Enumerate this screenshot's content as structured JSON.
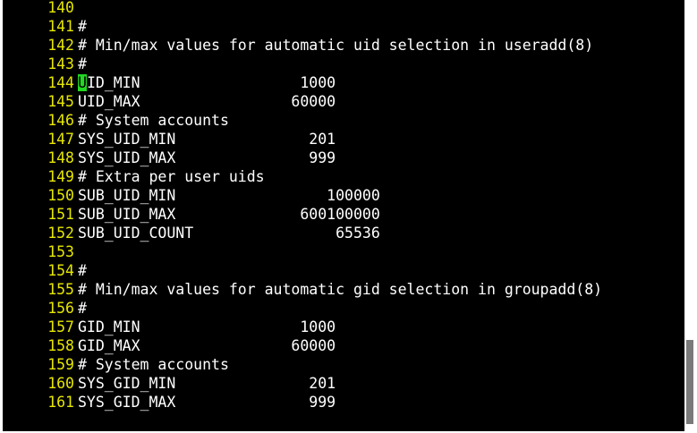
{
  "editor": {
    "lines": [
      {
        "num": "140",
        "text": ""
      },
      {
        "num": "141",
        "text": "#"
      },
      {
        "num": "142",
        "text": "# Min/max values for automatic uid selection in useradd(8)"
      },
      {
        "num": "143",
        "text": "#"
      },
      {
        "num": "144",
        "text": "UID_MIN                  1000",
        "cursor_char": "U",
        "rest": "ID_MIN                  1000"
      },
      {
        "num": "145",
        "text": "UID_MAX                 60000"
      },
      {
        "num": "146",
        "text": "# System accounts"
      },
      {
        "num": "147",
        "text": "SYS_UID_MIN               201"
      },
      {
        "num": "148",
        "text": "SYS_UID_MAX               999"
      },
      {
        "num": "149",
        "text": "# Extra per user uids"
      },
      {
        "num": "150",
        "text": "SUB_UID_MIN                 100000"
      },
      {
        "num": "151",
        "text": "SUB_UID_MAX              600100000"
      },
      {
        "num": "152",
        "text": "SUB_UID_COUNT                65536"
      },
      {
        "num": "153",
        "text": ""
      },
      {
        "num": "154",
        "text": "#"
      },
      {
        "num": "155",
        "text": "# Min/max values for automatic gid selection in groupadd(8)"
      },
      {
        "num": "156",
        "text": "#"
      },
      {
        "num": "157",
        "text": "GID_MIN                  1000"
      },
      {
        "num": "158",
        "text": "GID_MAX                 60000"
      },
      {
        "num": "159",
        "text": "# System accounts"
      },
      {
        "num": "160",
        "text": "SYS_GID_MIN               201"
      },
      {
        "num": "161",
        "text": "SYS_GID_MAX               999"
      }
    ]
  },
  "colors": {
    "background": "#000000",
    "line_number": "#e6e600",
    "text": "#ffffff",
    "cursor": "#22d822"
  },
  "scrollbar": {
    "position_fraction": 0.92
  }
}
